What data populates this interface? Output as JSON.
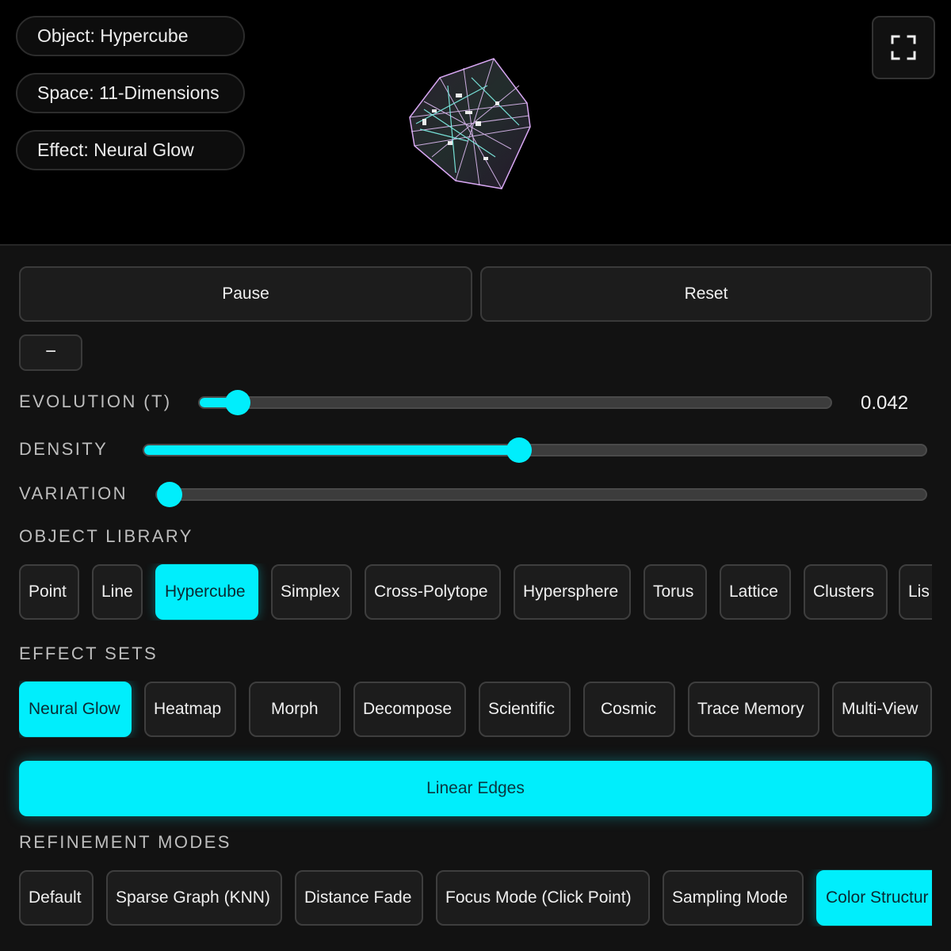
{
  "viewport": {
    "info_pills": [
      {
        "label": "Object: Hypercube"
      },
      {
        "label": "Space: 11-Dimensions"
      },
      {
        "label": "Effect: Neural Glow"
      }
    ],
    "fullscreen_icon": "fullscreen-icon"
  },
  "controls": {
    "pause_label": "Pause",
    "reset_label": "Reset",
    "collapse_label": "−"
  },
  "sliders": {
    "evolution": {
      "label": "EVOLUTION (T)",
      "value": "0.042",
      "level": 0.06
    },
    "density": {
      "label": "DENSITY",
      "level": 0.48
    },
    "variation": {
      "label": "VARIATION",
      "level": 0.0
    }
  },
  "object_library": {
    "heading": "OBJECT LIBRARY",
    "items": [
      "Point",
      "Line",
      "Hypercube",
      "Simplex",
      "Cross-Polytope",
      "Hypersphere",
      "Torus",
      "Lattice",
      "Clusters",
      "Lis"
    ],
    "active": "Hypercube"
  },
  "effect_sets": {
    "heading": "EFFECT SETS",
    "items": [
      "Neural Glow",
      "Heatmap",
      "Morph",
      "Decompose",
      "Scientific",
      "Cosmic",
      "Trace Memory",
      "Multi-View"
    ],
    "active": "Neural Glow"
  },
  "edge_mode": {
    "label": "Linear Edges"
  },
  "refinement_modes": {
    "heading": "REFINEMENT MODES",
    "items": [
      "Default",
      "Sparse Graph (KNN)",
      "Distance Fade",
      "Focus Mode (Click Point)",
      "Sampling Mode",
      "Color Structur"
    ],
    "active": "Color Structur"
  },
  "colors": {
    "accent": "#00eefc",
    "panel": "#121212",
    "button": "#1c1c1c"
  }
}
